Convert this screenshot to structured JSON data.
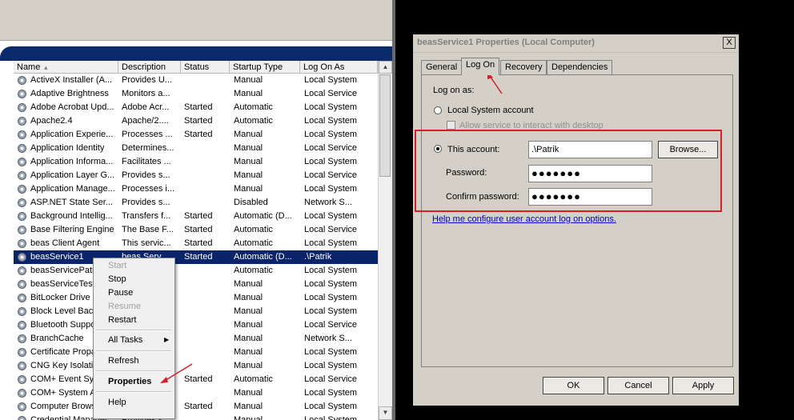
{
  "services": {
    "columns": {
      "name": "Name",
      "description": "Description",
      "status": "Status",
      "startup_type": "Startup Type",
      "log_on_as": "Log On As"
    },
    "rows": [
      {
        "name": "ActiveX Installer (A...",
        "description": "Provides U...",
        "status": "",
        "startup": "Manual",
        "logon": "Local System"
      },
      {
        "name": "Adaptive Brightness",
        "description": "Monitors a...",
        "status": "",
        "startup": "Manual",
        "logon": "Local Service"
      },
      {
        "name": "Adobe Acrobat Upd...",
        "description": "Adobe Acr...",
        "status": "Started",
        "startup": "Automatic",
        "logon": "Local System"
      },
      {
        "name": "Apache2.4",
        "description": "Apache/2....",
        "status": "Started",
        "startup": "Automatic",
        "logon": "Local System"
      },
      {
        "name": "Application Experie...",
        "description": "Processes ...",
        "status": "Started",
        "startup": "Manual",
        "logon": "Local System"
      },
      {
        "name": "Application Identity",
        "description": "Determines...",
        "status": "",
        "startup": "Manual",
        "logon": "Local Service"
      },
      {
        "name": "Application Informa...",
        "description": "Facilitates ...",
        "status": "",
        "startup": "Manual",
        "logon": "Local System"
      },
      {
        "name": "Application Layer G...",
        "description": "Provides s...",
        "status": "",
        "startup": "Manual",
        "logon": "Local Service"
      },
      {
        "name": "Application Manage...",
        "description": "Processes i...",
        "status": "",
        "startup": "Manual",
        "logon": "Local System"
      },
      {
        "name": "ASP.NET State Ser...",
        "description": "Provides s...",
        "status": "",
        "startup": "Disabled",
        "logon": "Network S..."
      },
      {
        "name": "Background Intellig...",
        "description": "Transfers f...",
        "status": "Started",
        "startup": "Automatic (D...",
        "logon": "Local System"
      },
      {
        "name": "Base Filtering Engine",
        "description": "The Base F...",
        "status": "Started",
        "startup": "Automatic",
        "logon": "Local Service"
      },
      {
        "name": "beas Client Agent",
        "description": "This servic...",
        "status": "Started",
        "startup": "Automatic",
        "logon": "Local System"
      },
      {
        "name": "beasService1",
        "description": "beas Serv...",
        "status": "Started",
        "startup": "Automatic (D...",
        "logon": ".\\Patrik"
      },
      {
        "name": "beasServicePatr...",
        "description": "",
        "status": "",
        "startup": "Automatic",
        "logon": "Local System"
      },
      {
        "name": "beasServiceTest...",
        "description": "",
        "status": "",
        "startup": "Manual",
        "logon": "Local System"
      },
      {
        "name": "BitLocker Drive E...",
        "description": "",
        "status": "",
        "startup": "Manual",
        "logon": "Local System"
      },
      {
        "name": "Block Level Back...",
        "description": "",
        "status": "",
        "startup": "Manual",
        "logon": "Local System"
      },
      {
        "name": "Bluetooth Suppo...",
        "description": "",
        "status": "",
        "startup": "Manual",
        "logon": "Local Service"
      },
      {
        "name": "BranchCache",
        "description": "",
        "status": "",
        "startup": "Manual",
        "logon": "Network S..."
      },
      {
        "name": "Certificate Propa...",
        "description": "",
        "status": "",
        "startup": "Manual",
        "logon": "Local System"
      },
      {
        "name": "CNG Key Isolatio...",
        "description": "",
        "status": "",
        "startup": "Manual",
        "logon": "Local System"
      },
      {
        "name": "COM+ Event Sy...",
        "description": "",
        "status": "Started",
        "startup": "Automatic",
        "logon": "Local Service"
      },
      {
        "name": "COM+ System A...",
        "description": "",
        "status": "",
        "startup": "Manual",
        "logon": "Local System"
      },
      {
        "name": "Computer Brows...",
        "description": "",
        "status": "Started",
        "startup": "Manual",
        "logon": "Local System"
      },
      {
        "name": "Credential Manager",
        "description": "Provides s...",
        "status": "",
        "startup": "Manual",
        "logon": "Local System"
      }
    ],
    "selected_row": "beasService1"
  },
  "context_menu": {
    "start": "Start",
    "stop": "Stop",
    "pause": "Pause",
    "resume": "Resume",
    "restart": "Restart",
    "all_tasks": "All Tasks",
    "refresh": "Refresh",
    "properties": "Properties",
    "help": "Help"
  },
  "dialog": {
    "title": "beasService1 Properties (Local Computer)",
    "close": "X",
    "tabs": [
      "General",
      "Log On",
      "Recovery",
      "Dependencies"
    ],
    "active_tab": "Log On",
    "log_on_as": "Log on as:",
    "local_system_account": "Local System account",
    "allow_interact": "Allow service to interact with desktop",
    "this_account": "This account:",
    "account_value": ".\\Patrik",
    "browse": "Browse...",
    "password": "Password:",
    "password_value": "●●●●●●●",
    "confirm_password": "Confirm password:",
    "confirm_value": "●●●●●●●",
    "help_link": "Help me configure user account log on options.",
    "ok": "OK",
    "cancel": "Cancel",
    "apply": "Apply"
  },
  "accent_colors": {
    "selection": "#0a246a",
    "annotation": "#d0202a",
    "link": "#0000cc"
  }
}
